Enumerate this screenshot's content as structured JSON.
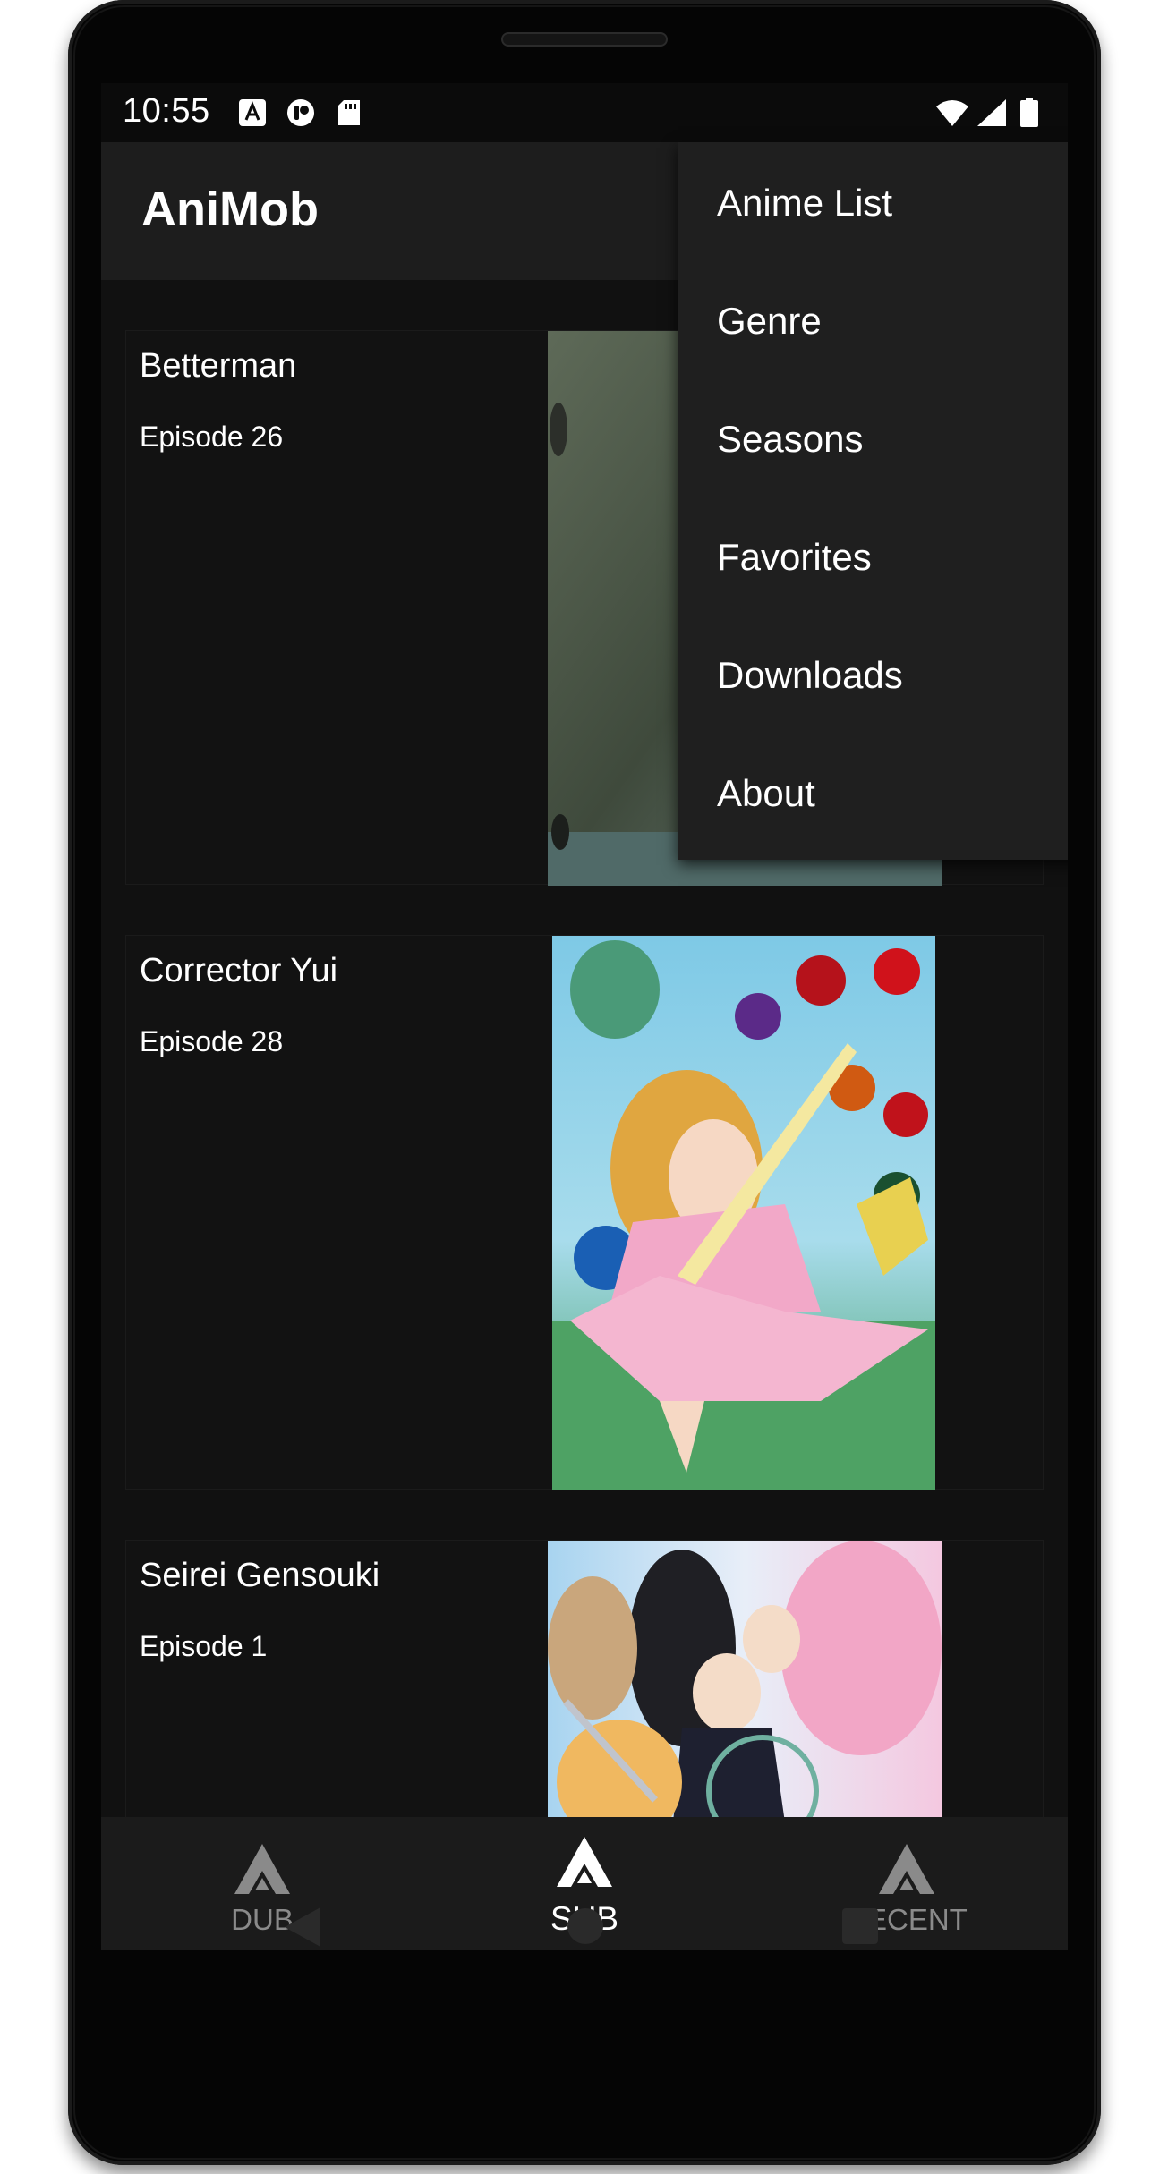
{
  "status_bar": {
    "time": "10:55",
    "icons": [
      "a-icon",
      "p-circle-icon",
      "sd-card-icon",
      "wifi-icon",
      "cellular-signal-icon",
      "battery-icon"
    ]
  },
  "app_bar": {
    "title": "AniMob"
  },
  "menu": {
    "items": [
      {
        "label": "Anime List"
      },
      {
        "label": "Genre"
      },
      {
        "label": "Seasons"
      },
      {
        "label": "Favorites"
      },
      {
        "label": "Downloads"
      },
      {
        "label": "About"
      }
    ]
  },
  "list": {
    "items": [
      {
        "title": "Betterman",
        "episode": "Episode 26"
      },
      {
        "title": "Corrector Yui",
        "episode": "Episode 28"
      },
      {
        "title": "Seirei Gensouki",
        "episode": "Episode 1"
      }
    ]
  },
  "bottom_nav": {
    "items": [
      {
        "label": "DUB",
        "state": "inactive"
      },
      {
        "label": "SUB",
        "state": "active"
      },
      {
        "label": "RECENT",
        "state": "inactive"
      }
    ]
  },
  "colors": {
    "background": "#111111",
    "app_bar": "#1d1d1d",
    "menu": "#1f1f1f",
    "text": "#ffffff",
    "inactive_nav": "#8a8a8a"
  }
}
